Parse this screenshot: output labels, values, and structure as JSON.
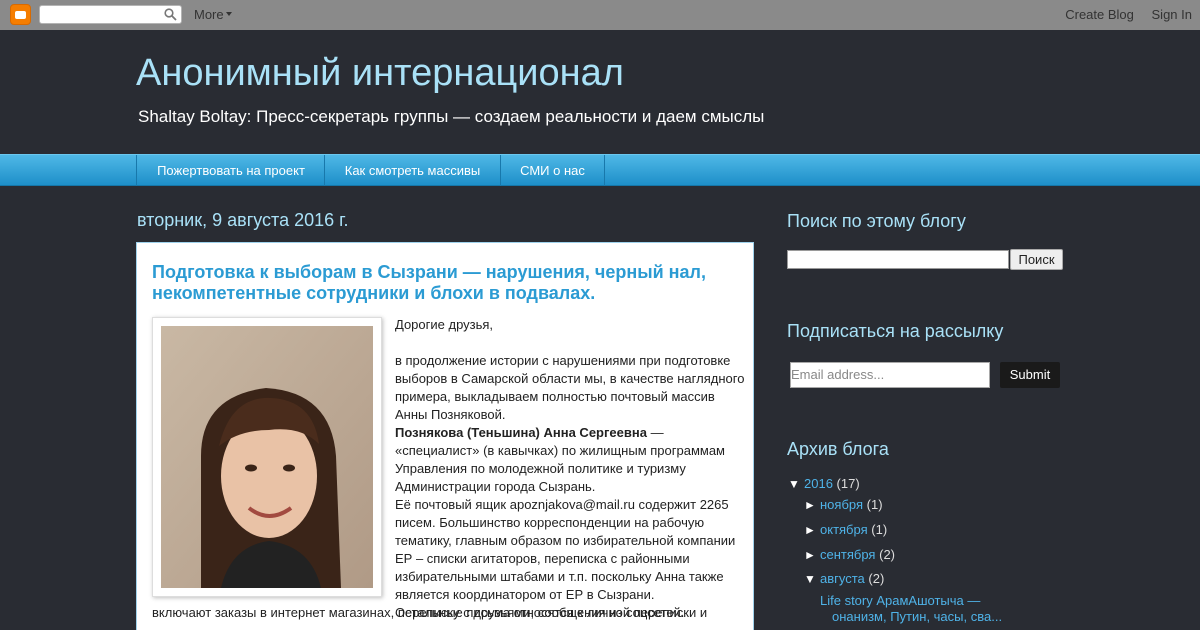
{
  "navbar": {
    "logo_icon": "blogger-logo-icon",
    "search_placeholder": "",
    "more_label": "More",
    "create_blog": "Create Blog",
    "sign_in": "Sign In"
  },
  "header": {
    "title": "Анонимный интернационал",
    "description": "Shaltay Boltay: Пресс-секретарь группы — создаем реальности и даем смыслы"
  },
  "tabs": [
    {
      "label": "Пожертвовать на проект"
    },
    {
      "label": "Как смотреть массивы"
    },
    {
      "label": "СМИ о нас"
    }
  ],
  "main": {
    "date_header": "вторник, 9 августа 2016 г.",
    "post": {
      "title_line1": "Подготовка к выборам в Сызрани — нарушения, черный нал,",
      "title_line2": "некомпетентные сотрудники и блохи в подвалах.",
      "greeting": "Дорогие друзья,",
      "p1": "в продолжение истории с нарушениями при подготовке выборов в Самарской области мы, в качестве наглядного примера, выкладываем полностью почтовый массив Анны Позняковой.",
      "name_bold": "Познякова (Теньшина) Анна Сергеевна",
      "p2_rest": " — «специалист» (в кавычках) по жилищным программам Управления по молодежной политике и туризму Администрации города Сызрань.",
      "p3": "Её почтовый ящик apoznjakova@mail.ru содержит 2265 писем. Большинство корреспонденции на рабочую тематику, главным образом по избирательной компании ЕР – списки агитаторов, переписка с районными избирательными штабами и т.п. поскольку Анна также является координатором от ЕР в Сызрани.",
      "p4_start": "Остальные письма относятся к личной переписки и",
      "p4_wide": "включают заказы в интернет магазинах, переписку с друзьями, сообщения из соцсетей."
    }
  },
  "sidebar": {
    "search_heading": "Поиск по этому блогу",
    "search_button": "Поиск",
    "subscribe_heading": "Подписаться на рассылку",
    "email_placeholder": "Email address...",
    "submit_label": "Submit",
    "archive_heading": "Архив блога",
    "archive": [
      {
        "toggle": "▼",
        "label": "2016",
        "count": "(17)"
      },
      {
        "toggle": "►",
        "label": "ноября",
        "count": "(1)"
      },
      {
        "toggle": "►",
        "label": "октября",
        "count": "(1)"
      },
      {
        "toggle": "►",
        "label": "сентября",
        "count": "(2)"
      },
      {
        "toggle": "▼",
        "label": "августа",
        "count": "(2)"
      }
    ],
    "archive_post_line1": "Life story АрамАшотыча —",
    "archive_post_line2": "онанизм, Путин, часы, сва..."
  },
  "colors": {
    "background": "#292c33",
    "title": "#a9e1f7",
    "tab_bar": "#2a9fd8",
    "link": "#4fb3e8",
    "post_title": "#2b9bd3"
  }
}
